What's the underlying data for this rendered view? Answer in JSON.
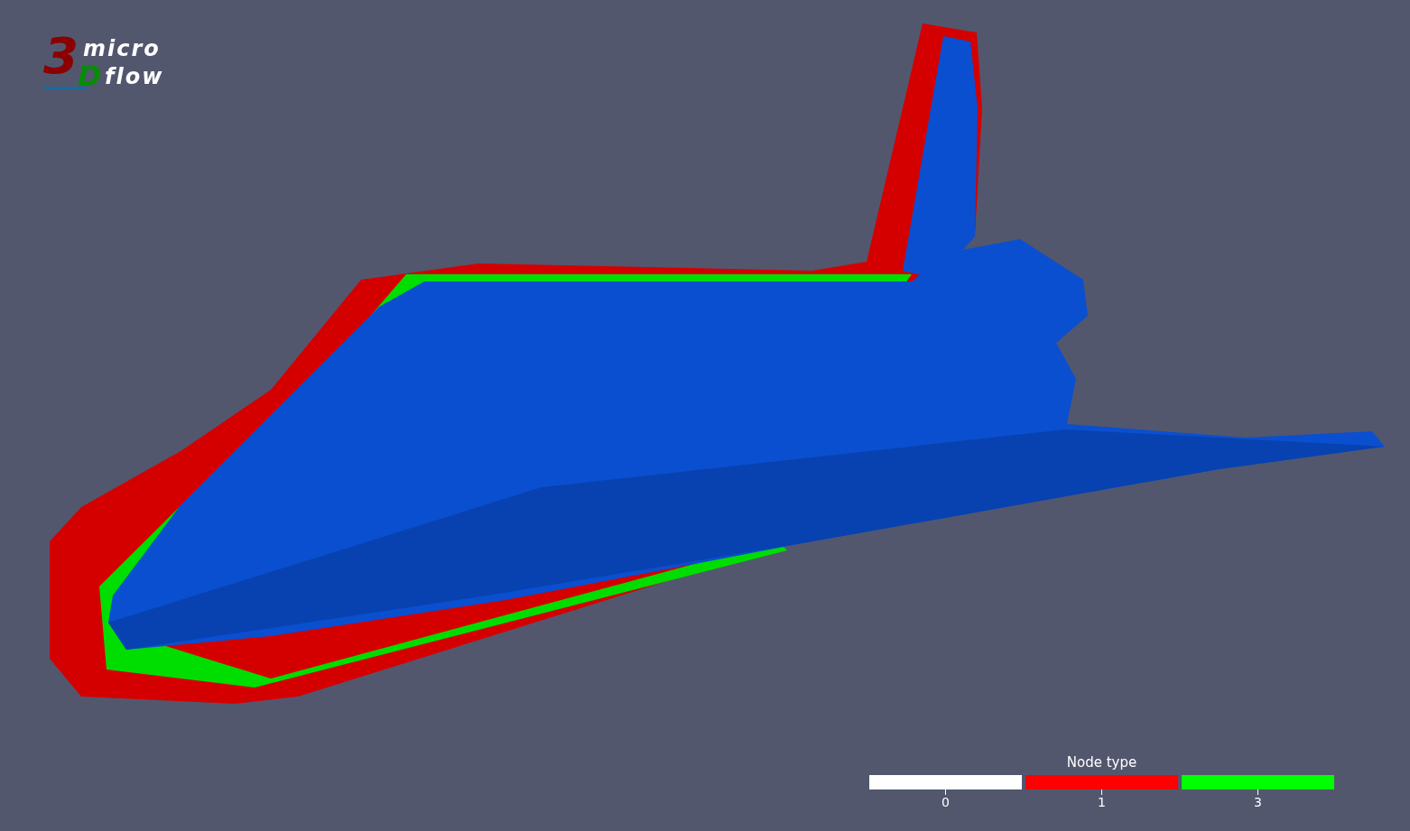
{
  "logo": {
    "digit": "3",
    "letter": "D",
    "word_top": "micro",
    "word_bottom": "flow"
  },
  "legend": {
    "title": "Node type",
    "entries": [
      {
        "label": "0",
        "color": "#ffffff"
      },
      {
        "label": "1",
        "color": "#ff0000"
      },
      {
        "label": "3",
        "color": "#00ff00"
      }
    ]
  }
}
